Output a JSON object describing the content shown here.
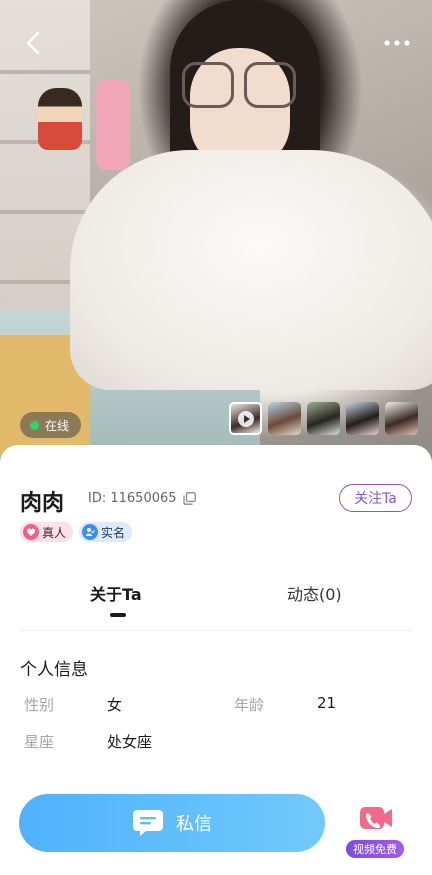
{
  "profile": {
    "name": "肉肉",
    "id_text": "ID: 11650065",
    "follow_label": "关注Ta",
    "online_status": "在线",
    "tags": [
      {
        "label": "真人",
        "icon": "heart-check-icon",
        "color": "#f25f86"
      },
      {
        "label": "实名",
        "icon": "user-verified-icon",
        "color": "#3b8ef0"
      }
    ]
  },
  "gallery": {
    "thumbnails": [
      {
        "icon": "play-icon",
        "active": true
      },
      {
        "active": false
      },
      {
        "active": false
      },
      {
        "active": false
      },
      {
        "active": false
      }
    ]
  },
  "tabs": [
    {
      "label": "关于Ta",
      "active": true
    },
    {
      "label": "动态(0)",
      "active": false
    }
  ],
  "personal_info": {
    "title": "个人信息",
    "fields": [
      {
        "label": "性别",
        "value": "女"
      },
      {
        "label": "年龄",
        "value": "21"
      },
      {
        "label": "星座",
        "value": "处女座"
      }
    ]
  },
  "actions": {
    "message_label": "私信",
    "video_badge": "视频免费"
  },
  "colors": {
    "accent_purple": "#8a56c8",
    "message_gradient_start": "#4fb2fb",
    "message_gradient_end": "#72c9fb",
    "online_green": "#2fd36a"
  },
  "icons": {
    "back": "chevron-left-icon",
    "more": "more-dots-icon",
    "copy": "copy-icon",
    "message": "chat-bubble-icon",
    "video": "video-call-icon"
  }
}
